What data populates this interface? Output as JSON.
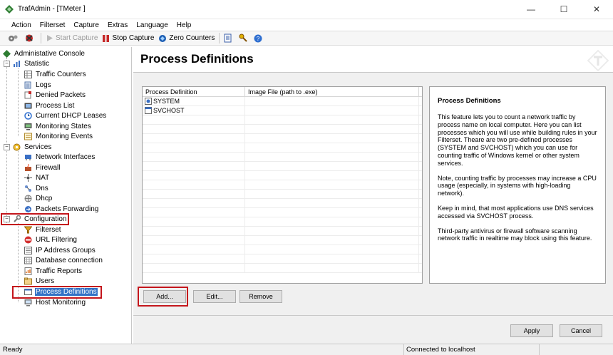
{
  "window": {
    "title": "TrafAdmin - [TMeter ]",
    "minimize": "—",
    "maximize": "☐",
    "close": "✕"
  },
  "menu": [
    "Action",
    "Filterset",
    "Capture",
    "Extras",
    "Language",
    "Help"
  ],
  "toolbar": {
    "start_capture": "Start Capture",
    "stop_capture": "Stop Capture",
    "zero_counters": "Zero Counters"
  },
  "tree": {
    "root": "Administative Console",
    "statistic": {
      "label": "Statistic",
      "items": [
        "Traffic Counters",
        "Logs",
        "Denied Packets",
        "Process List",
        "Current DHCP Leases",
        "Monitoring States",
        "Monitoring Events"
      ]
    },
    "services": {
      "label": "Services",
      "items": [
        "Network Interfaces",
        "Firewall",
        "NAT",
        "Dns",
        "Dhcp",
        "Packets Forwarding"
      ]
    },
    "configuration": {
      "label": "Configuration",
      "items": [
        "Filterset",
        "URL Filtering",
        "IP Address Groups",
        "Database connection",
        "Traffic Reports",
        "Users",
        "Process Definitions",
        "Host Monitoring"
      ]
    },
    "expand_minus": "−"
  },
  "page": {
    "title": "Process Definitions"
  },
  "listview": {
    "columns": [
      "Process Definition",
      "Image File (path to .exe)"
    ],
    "rows": [
      {
        "name": "SYSTEM",
        "path": ""
      },
      {
        "name": "SVCHOST",
        "path": ""
      }
    ]
  },
  "buttons": {
    "add": "Add...",
    "edit": "Edit...",
    "remove": "Remove",
    "apply": "Apply",
    "cancel": "Cancel"
  },
  "info": {
    "title": "Process Definitions",
    "paragraphs": [
      "This feature lets you to count a network traffic by process name on local computer. Here you can list processes which you will use while building rules in your Filterset. Theare are two pre-defined processes (SYSTEM and SVCHOST) which you can use for counting traffic of Windows kernel or other system services.",
      "Note, counting traffic by processes may increase a CPU usage (especially, in systems with high-loading network).",
      "Keep in mind, that most applications use DNS services accessed via SVCHOST process.",
      "Third-party antivirus or firewall software scanning network traffic in realtime may block using this feature."
    ]
  },
  "status": {
    "left": "Ready",
    "right": "Connected to localhost"
  },
  "colors": {
    "selection": "#3373c6",
    "highlight": "#c4161c"
  }
}
